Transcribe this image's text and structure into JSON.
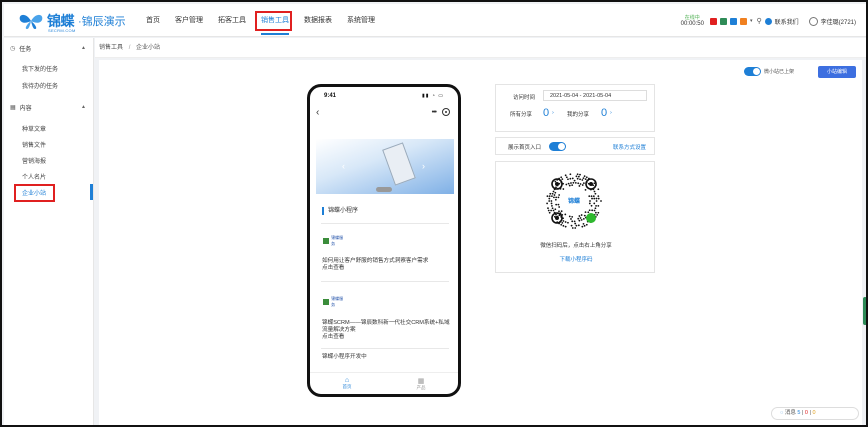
{
  "app": {
    "brand": "锦蝶",
    "brand_sub": "SECRM.COM",
    "org_name": "·锦辰演示"
  },
  "topnav": {
    "items": [
      {
        "label": "首页",
        "active": false
      },
      {
        "label": "客户管理",
        "active": false
      },
      {
        "label": "拓客工具",
        "active": false
      },
      {
        "label": "销售工具",
        "active": true
      },
      {
        "label": "数据报表",
        "active": false
      },
      {
        "label": "系统管理",
        "active": false
      }
    ],
    "clock_status": "在线中",
    "clock_time": "00:00:50",
    "contact_label": "联系我们",
    "user_name": "李佳璐(2721)",
    "quick_icon_colors": [
      "#e02020",
      "#2e8b57",
      "#1e7fd6",
      "#f08020",
      "#555555"
    ]
  },
  "sidebar": {
    "groups": [
      {
        "label": "任务",
        "items": [
          "我下发的任务",
          "我待办的任务"
        ]
      },
      {
        "label": "内容",
        "items": [
          "种草文章",
          "销售文件",
          "营销海报",
          "个人名片",
          "企业小站"
        ]
      }
    ],
    "active_item": "企业小站"
  },
  "breadcrumb": {
    "parent": "销售工具",
    "separator": "/",
    "current": "企业小站"
  },
  "toolbar": {
    "toggle_label": "微小站已上架",
    "toggle_on": true,
    "settings_button": "小站编辑"
  },
  "phone": {
    "time": "9:41",
    "miniprogram_title": "锦蝶小程序",
    "articles": [
      {
        "logo_text": "锦蝶服务",
        "text": "如何用让客户舒服的销售方式洞察客户需求",
        "cta": "点击查看"
      },
      {
        "logo_text": "锦蝶服务",
        "text": "锦蝶SCRM——锦辰数科新一代社交CRM系统+私域流量解决方案",
        "cta": "点击查看"
      }
    ],
    "footer_note": "锦蝶小程序开发中",
    "tabs": [
      {
        "label": "首页",
        "active": true
      },
      {
        "label": "产品",
        "active": false
      }
    ]
  },
  "stats": {
    "date_label": "访问时间",
    "date_range": "2021-05-04 - 2021-05-04",
    "all_share_label": "所有分享",
    "all_share_value": "0",
    "my_share_label": "我的分享",
    "my_share_value": "0"
  },
  "entry": {
    "label": "展示首页入口",
    "toggle_on": true,
    "contact_settings": "联系方式设置"
  },
  "qrcode": {
    "logo_text": "锦蝶",
    "hint": "微信扫码后，点击右上角分享",
    "download": "下载小程序码"
  },
  "messages": {
    "label": "消息",
    "count_blue": "5",
    "count_red": "0",
    "count_orange": "0",
    "sep": "|"
  }
}
